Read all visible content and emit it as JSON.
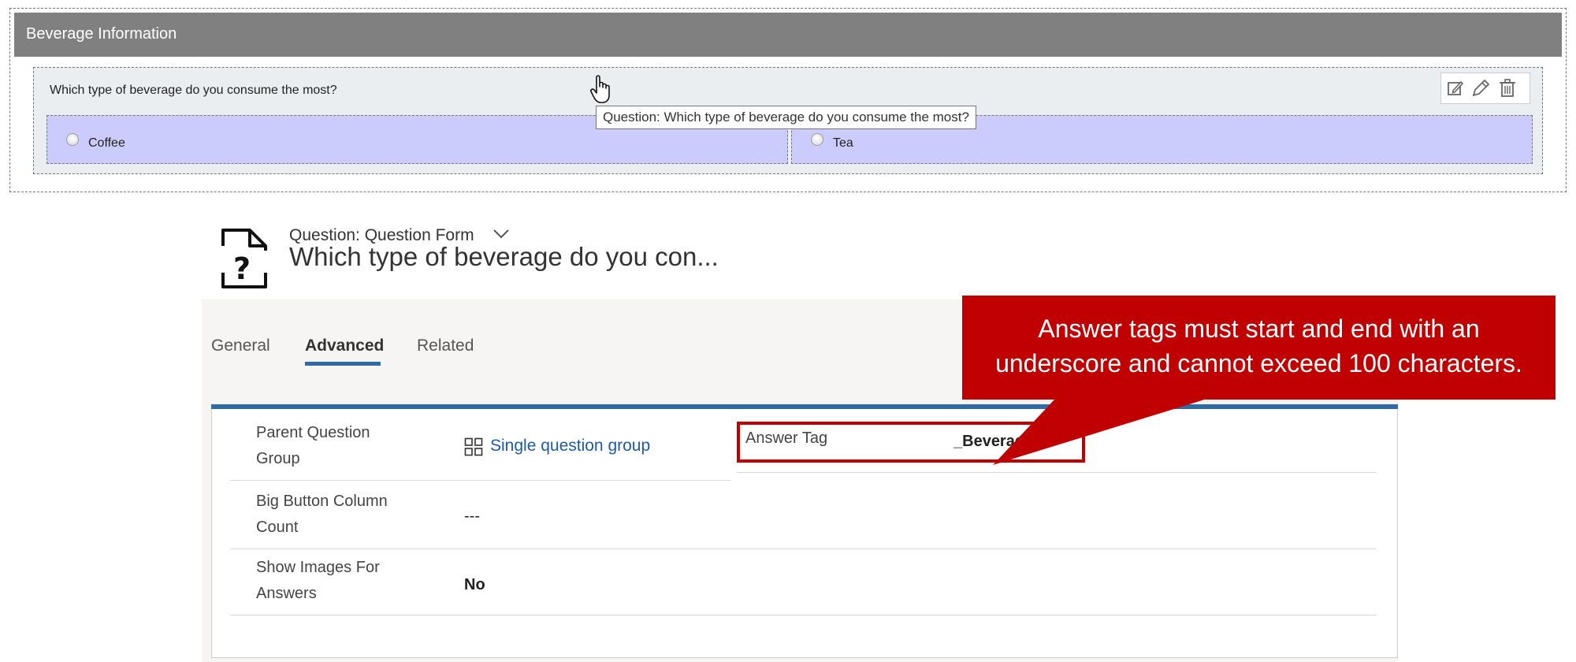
{
  "preview": {
    "section_title": "Beverage Information",
    "question_text": "Which type of beverage do you consume the most?",
    "answers": [
      {
        "label": "Coffee"
      },
      {
        "label": "Tea"
      }
    ],
    "tooltip": "Question: Which type of beverage do you consume the most?",
    "toolbar_icons": [
      "edit-square-icon",
      "pencil-icon",
      "trash-icon"
    ]
  },
  "form": {
    "entity_line": "Question: Question Form",
    "record_title": "Which type of beverage do you con...",
    "tabs": [
      {
        "label": "General",
        "active": false
      },
      {
        "label": "Advanced",
        "active": true
      },
      {
        "label": "Related",
        "active": false
      }
    ],
    "fields": {
      "parent_group": {
        "label_line1": "Parent Question",
        "label_line2": "Group",
        "value": "Single question group"
      },
      "big_button": {
        "label_line1": "Big Button Column",
        "label_line2": "Count",
        "value": "---"
      },
      "show_images": {
        "label_line1": "Show Images For",
        "label_line2": "Answers",
        "value": "No"
      },
      "answer_tag": {
        "label": "Answer Tag",
        "value": "_Beverage_"
      }
    }
  },
  "callout": {
    "line1": "Answer tags must start and end with an",
    "line2": "underscore and cannot exceed 100 characters."
  },
  "colors": {
    "header_gray": "#808080",
    "answer_fill": "#cbcbfc",
    "accent_blue": "#2f6ba8",
    "link_blue": "#1d5ba8",
    "callout_red": "#c00000"
  }
}
